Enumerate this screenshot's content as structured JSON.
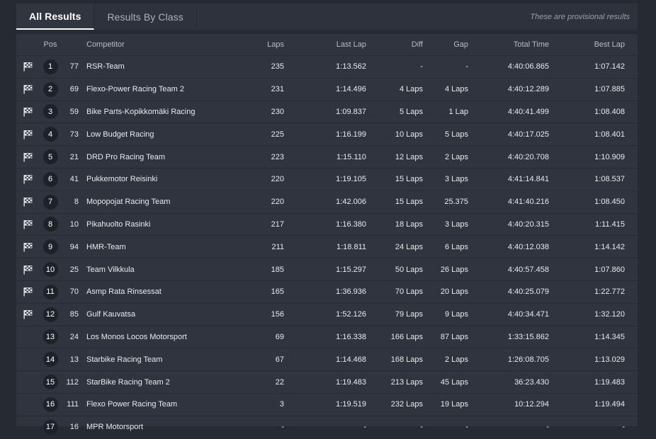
{
  "tabs": [
    {
      "label": "All Results"
    },
    {
      "label": "Results By Class"
    }
  ],
  "provisional_note": "These are provisional results",
  "columns": {
    "pos": "Pos",
    "competitor": "Competitor",
    "laps": "Laps",
    "last_lap": "Last Lap",
    "diff": "Diff",
    "gap": "Gap",
    "total_time": "Total Time",
    "best_lap": "Best Lap"
  },
  "rows": [
    {
      "pos": "1",
      "num": "77",
      "competitor": "RSR-Team",
      "laps": "235",
      "last_lap": "1:13.562",
      "diff": "-",
      "gap": "-",
      "total_time": "4:40:06.865",
      "best_lap": "1:07.142",
      "flag": "checkered-flag-icon"
    },
    {
      "pos": "2",
      "num": "69",
      "competitor": "Flexo-Power Racing Team 2",
      "laps": "231",
      "last_lap": "1:14.496",
      "diff": "4 Laps",
      "gap": "4 Laps",
      "total_time": "4:40:12.289",
      "best_lap": "1:07.885",
      "flag": "checkered-flag-icon"
    },
    {
      "pos": "3",
      "num": "59",
      "competitor": "Bike Parts-Kopikkomäki Racing",
      "laps": "230",
      "last_lap": "1:09.837",
      "diff": "5 Laps",
      "gap": "1 Lap",
      "total_time": "4:40:41.499",
      "best_lap": "1:08.408",
      "flag": "checkered-flag-icon"
    },
    {
      "pos": "4",
      "num": "73",
      "competitor": "Low Budget Racing",
      "laps": "225",
      "last_lap": "1:16.199",
      "diff": "10 Laps",
      "gap": "5 Laps",
      "total_time": "4:40:17.025",
      "best_lap": "1:08.401",
      "flag": "checkered-flag-icon"
    },
    {
      "pos": "5",
      "num": "21",
      "competitor": "DRD Pro Racing Team",
      "laps": "223",
      "last_lap": "1:15.110",
      "diff": "12 Laps",
      "gap": "2 Laps",
      "total_time": "4:40:20.708",
      "best_lap": "1:10.909",
      "flag": "checkered-flag-icon"
    },
    {
      "pos": "6",
      "num": "41",
      "competitor": "Pukkemotor Reisinki",
      "laps": "220",
      "last_lap": "1:19.105",
      "diff": "15 Laps",
      "gap": "3 Laps",
      "total_time": "4:41:14.841",
      "best_lap": "1:08.537",
      "flag": "checkered-flag-icon"
    },
    {
      "pos": "7",
      "num": "8",
      "competitor": "Mopopojat Racing Team",
      "laps": "220",
      "last_lap": "1:42.006",
      "diff": "15 Laps",
      "gap": "25.375",
      "total_time": "4:41:40.216",
      "best_lap": "1:08.450",
      "flag": "checkered-flag-icon"
    },
    {
      "pos": "8",
      "num": "10",
      "competitor": "Pikahuolto Rasinki",
      "laps": "217",
      "last_lap": "1:16.380",
      "diff": "18 Laps",
      "gap": "3 Laps",
      "total_time": "4:40:20.315",
      "best_lap": "1:11.415",
      "flag": "checkered-flag-icon"
    },
    {
      "pos": "9",
      "num": "94",
      "competitor": "HMR-Team",
      "laps": "211",
      "last_lap": "1:18.811",
      "diff": "24 Laps",
      "gap": "6 Laps",
      "total_time": "4:40:12.038",
      "best_lap": "1:14.142",
      "flag": "checkered-flag-icon"
    },
    {
      "pos": "10",
      "num": "25",
      "competitor": "Team Vilkkula",
      "laps": "185",
      "last_lap": "1:15.297",
      "diff": "50 Laps",
      "gap": "26 Laps",
      "total_time": "4:40:57.458",
      "best_lap": "1:07.860",
      "flag": "checkered-flag-icon"
    },
    {
      "pos": "11",
      "num": "70",
      "competitor": "Asmp Rata Rinsessat",
      "laps": "165",
      "last_lap": "1:36.936",
      "diff": "70 Laps",
      "gap": "20 Laps",
      "total_time": "4:40:25.079",
      "best_lap": "1:22.772",
      "flag": "checkered-flag-icon"
    },
    {
      "pos": "12",
      "num": "85",
      "competitor": "Gulf Kauvatsa",
      "laps": "156",
      "last_lap": "1:52.126",
      "diff": "79 Laps",
      "gap": "9 Laps",
      "total_time": "4:40:34.471",
      "best_lap": "1:32.120",
      "flag": "checkered-flag-icon"
    },
    {
      "pos": "13",
      "num": "24",
      "competitor": "Los Monos Locos Motorsport",
      "laps": "69",
      "last_lap": "1:16.338",
      "diff": "166 Laps",
      "gap": "87 Laps",
      "total_time": "1:33:15.862",
      "best_lap": "1:14.345",
      "flag": ""
    },
    {
      "pos": "14",
      "num": "13",
      "competitor": "Starbike Racing Team",
      "laps": "67",
      "last_lap": "1:14.468",
      "diff": "168 Laps",
      "gap": "2 Laps",
      "total_time": "1:26:08.705",
      "best_lap": "1:13.029",
      "flag": ""
    },
    {
      "pos": "15",
      "num": "112",
      "competitor": "StarBike Racing Team 2",
      "laps": "22",
      "last_lap": "1:19.483",
      "diff": "213 Laps",
      "gap": "45 Laps",
      "total_time": "36:23.430",
      "best_lap": "1:19.483",
      "flag": ""
    },
    {
      "pos": "16",
      "num": "111",
      "competitor": "Flexo Power Racing Team",
      "laps": "3",
      "last_lap": "1:19.519",
      "diff": "232 Laps",
      "gap": "19 Laps",
      "total_time": "10:12.294",
      "best_lap": "1:19.494",
      "flag": ""
    },
    {
      "pos": "17",
      "num": "16",
      "competitor": "MPR Motorsport",
      "laps": "-",
      "last_lap": "-",
      "diff": "-",
      "gap": "-",
      "total_time": "-",
      "best_lap": "-",
      "flag": ""
    }
  ]
}
